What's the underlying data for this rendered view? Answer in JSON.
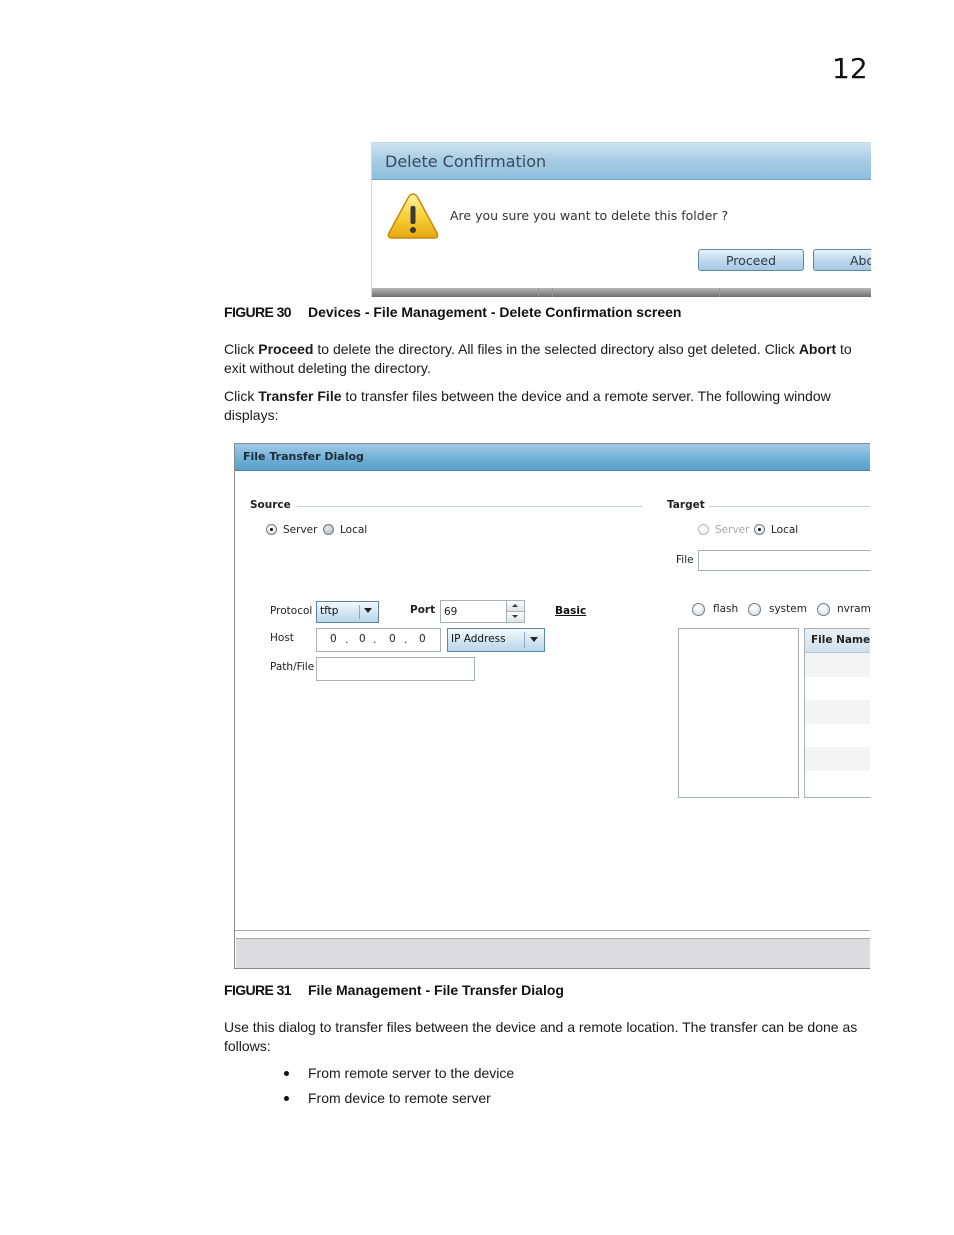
{
  "page_number": "12",
  "figure30": {
    "dialog": {
      "title": "Delete Confirmation",
      "icon": "warning-icon",
      "message": "Are you sure you want to delete this folder ?",
      "proceed_label": "Proceed",
      "abort_label": "Abo"
    },
    "caption_label": "FIGURE 30",
    "caption_text": "Devices - File Management - Delete Confirmation screen"
  },
  "paragraph1": {
    "t1": "Click ",
    "b1": "Proceed",
    "t2": " to delete the directory. All files in the selected directory also get deleted. Click ",
    "b2": "Abort",
    "t3": " to exit without deleting the directory."
  },
  "paragraph2": {
    "t1": "Click ",
    "b1": "Transfer File",
    "t2": " to transfer files between the device and a remote server. The following window displays:"
  },
  "figure31": {
    "dialog": {
      "title": "File Transfer Dialog",
      "source": {
        "label": "Source",
        "options": [
          {
            "label": "Server",
            "selected": true
          },
          {
            "label": "Local",
            "selected": false
          }
        ],
        "protocol_label": "Protocol",
        "protocol_value": "tftp",
        "port_label": "Port",
        "port_value": "69",
        "basic_link": "Basic",
        "host_label": "Host",
        "host_octets": [
          "0",
          "0",
          "0",
          "0"
        ],
        "host_type_value": "IP Address",
        "path_label": "Path/File",
        "path_value": ""
      },
      "target": {
        "label": "Target",
        "options": [
          {
            "label": "Server",
            "selected": false,
            "disabled": true
          },
          {
            "label": "Local",
            "selected": true
          }
        ],
        "file_label": "File",
        "file_value": "",
        "storage_options": [
          {
            "label": "flash",
            "selected": false
          },
          {
            "label": "system",
            "selected": false
          },
          {
            "label": "nvram",
            "selected": false
          }
        ],
        "grid_header": "File Name",
        "grid_rows": [
          "",
          "",
          "",
          "",
          "",
          ""
        ]
      }
    },
    "caption_label": "FIGURE 31",
    "caption_text": "File Management - File Transfer Dialog"
  },
  "paragraph3": "Use this dialog to transfer files between the device and a remote location. The transfer can be done as follows:",
  "bullets": [
    "From remote server to the device",
    "From device to remote server"
  ]
}
